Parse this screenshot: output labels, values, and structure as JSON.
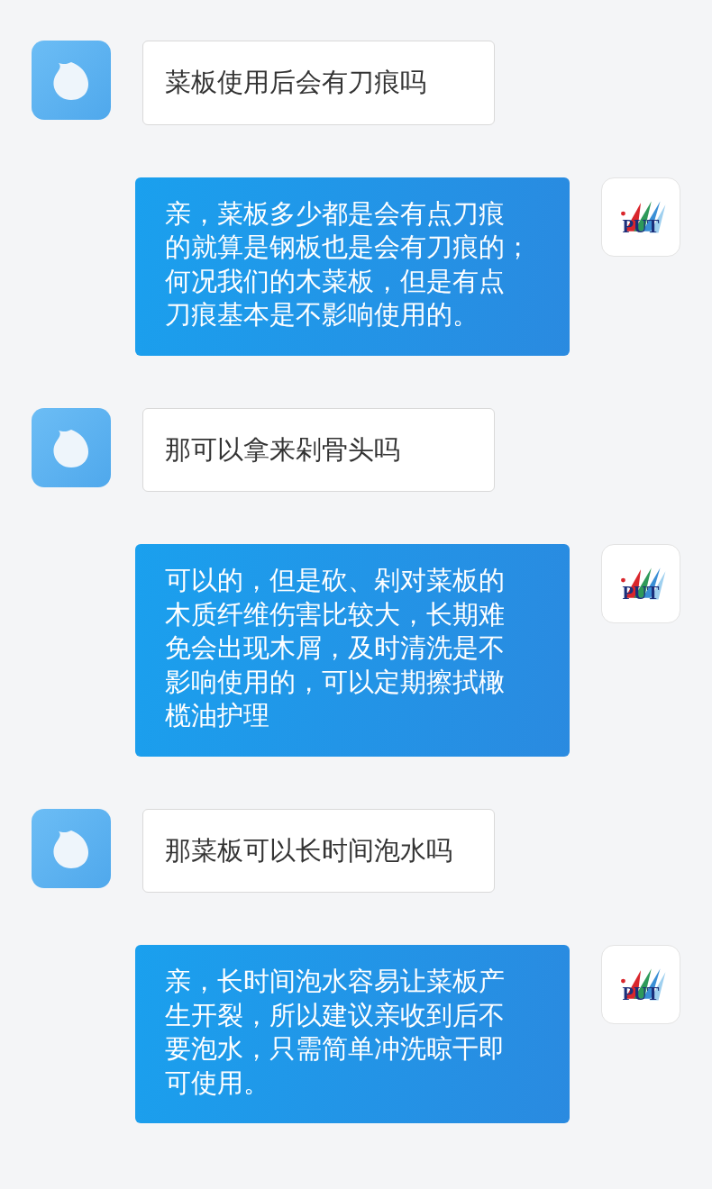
{
  "messages": [
    {
      "kind": "customer",
      "lines": [
        "菜板使用后会有刀痕吗"
      ]
    },
    {
      "kind": "shop",
      "logo": "PUT",
      "lines": [
        "亲，菜板多少都是会有点刀痕",
        "的就算是钢板也是会有刀痕的；",
        "何况我们的木菜板，但是有点",
        "刀痕基本是不影响使用的。"
      ]
    },
    {
      "kind": "customer",
      "lines": [
        "那可以拿来剁骨头吗"
      ]
    },
    {
      "kind": "shop",
      "logo": "PUT",
      "lines": [
        "可以的，但是砍、剁对菜板的",
        "木质纤维伤害比较大，长期难",
        "免会出现木屑，及时清洗是不",
        "影响使用的，可以定期擦拭橄",
        "榄油护理"
      ]
    },
    {
      "kind": "customer",
      "lines": [
        "那菜板可以长时间泡水吗"
      ]
    },
    {
      "kind": "shop",
      "logo": "PUT",
      "lines": [
        "亲，长时间泡水容易让菜板产",
        "生开裂，所以建议亲收到后不",
        "要泡水，只需简单冲洗晾干即",
        "可使用。"
      ]
    }
  ]
}
